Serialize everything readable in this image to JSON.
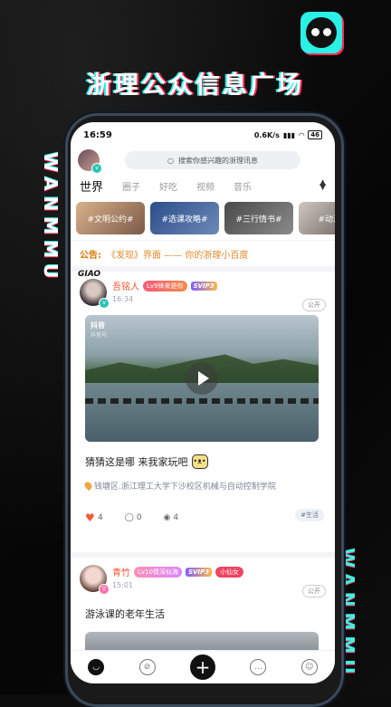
{
  "headline": "浙理公众信息广场",
  "side_word": "WANMMU",
  "status": {
    "time": "16:59",
    "speed": "0.6K/s",
    "battery": "46"
  },
  "search": {
    "placeholder": "搜索你感兴趣的浙理讯息"
  },
  "tabs": [
    "世界",
    "圈子",
    "好吃",
    "视频",
    "音乐"
  ],
  "topics": [
    "#文明公约#",
    "#选课攻略#",
    "#三行情书#",
    "#动漫#"
  ],
  "notice": {
    "label": "公告:",
    "text": "《发现》界面 —— 你的浙理小百度"
  },
  "posts": [
    {
      "avatar_text": "GIAO",
      "name": "吾铭人",
      "level": "Lv9锋来是你",
      "vip": "SVIP3",
      "time": "16:34",
      "visibility": "公开",
      "video_source": "抖音",
      "video_id": "抖音号:",
      "caption": "猜猜这是哪 来我家玩吧",
      "location": "钱塘区.浙江理工大学下沙校区机械与自动控制学院",
      "tag": "#生活",
      "likes": "4",
      "comments": "0",
      "views": "4"
    },
    {
      "name": "青竹",
      "level": "Lv10情深似海",
      "vip": "SVIP3",
      "title_tag": "小仙女",
      "time": "15:01",
      "visibility": "公开",
      "caption": "游泳课的老年生活"
    }
  ],
  "colors": {
    "accent_cyan": "#25f4ee",
    "accent_pink": "#fe2c55",
    "name_orange": "#f0542e",
    "notice_orange": "#e08a2c"
  }
}
